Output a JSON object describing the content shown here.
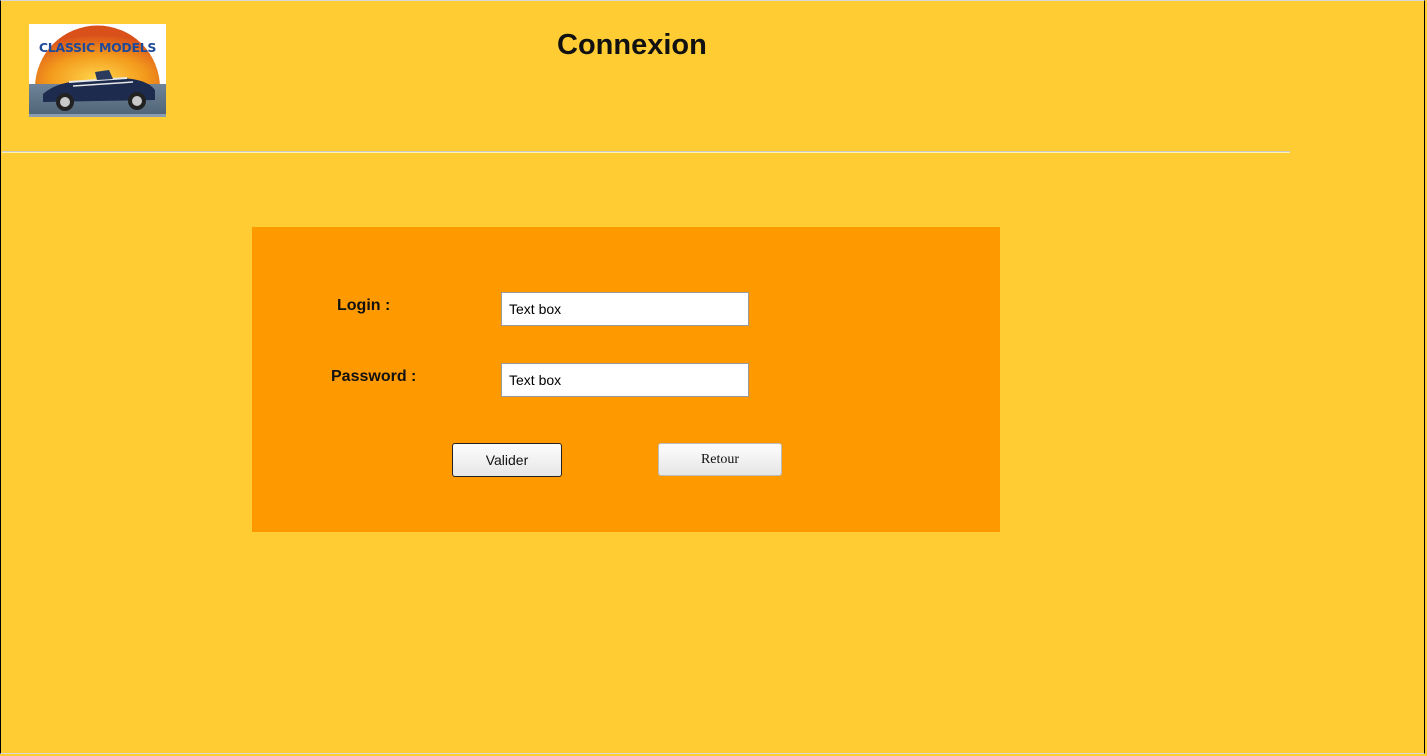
{
  "header": {
    "logo_text": "CLASSIC MODELS",
    "title": "Connexion"
  },
  "login_form": {
    "login_label": "Login :",
    "login_value": "Text box",
    "password_label": "Password :",
    "password_value": "Text box",
    "submit_label": "Valider",
    "back_label": "Retour"
  },
  "colors": {
    "page_background": "#FFCC33",
    "panel_background": "#FF9900",
    "logo_text": "#1F4A9A"
  }
}
